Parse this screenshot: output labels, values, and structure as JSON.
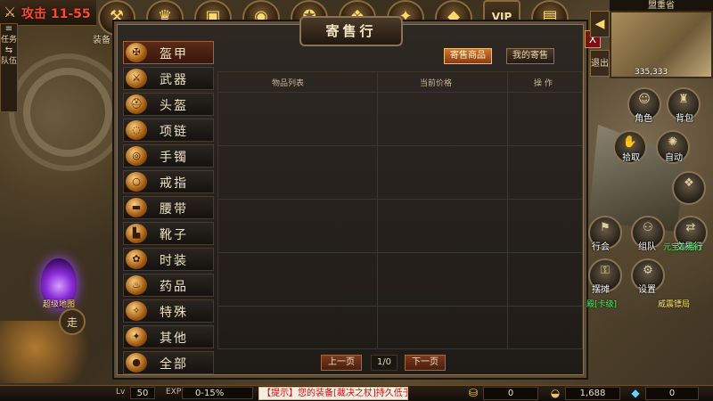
{
  "hud": {
    "attack_label": "攻击",
    "attack_range": "11-55",
    "equip_label": "装备",
    "vip_label": "VIP",
    "side_task": "任务",
    "side_team": "队伍",
    "walk_label": "走",
    "portal_label": "超级地图"
  },
  "panel": {
    "title": "寄售行",
    "close": "X",
    "tabs": {
      "sell": "寄售商品",
      "mine": "我的寄售"
    },
    "columns": [
      "物品列表",
      "当前价格",
      "操 作"
    ],
    "categories": [
      "盔甲",
      "武器",
      "头盔",
      "项链",
      "手镯",
      "戒指",
      "腰带",
      "靴子",
      "时装",
      "药品",
      "特殊",
      "其他",
      "全部"
    ],
    "pager": {
      "prev": "上一页",
      "page": "1/0",
      "next": "下一页"
    }
  },
  "right": {
    "map_name": "盟重省",
    "coords": "335,333",
    "exit_label": "退出",
    "buttons": {
      "role": "角色",
      "bag": "背包",
      "pickup": "拾取",
      "auto": "自动",
      "guild": "行会",
      "team": "组队",
      "trade": "交易行",
      "stall": "摆摊",
      "settings": "设置"
    },
    "npc_yuanbao": "元宝",
    "npc_trade": "元宝交易行",
    "npc_escort": "威震镖局",
    "npc_hall": "殿[卡级]"
  },
  "bottom": {
    "lv_label": "Lv",
    "level": "50",
    "exp_label": "EXP",
    "exp": "0-15%",
    "notice": "【提示】您的装备[裁决之杖]持久低于30%",
    "gold": "0",
    "yuanbao": "1,688",
    "diamond": "0"
  },
  "colors": {
    "accent": "#ff4a2a",
    "panel_border": "#5d4c38",
    "active_tab": "#d07a30"
  }
}
